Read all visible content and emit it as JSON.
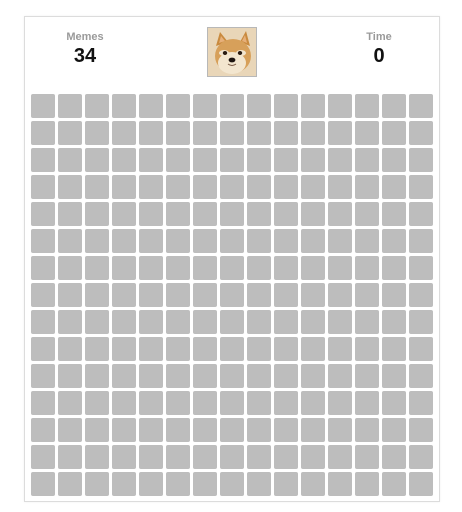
{
  "game": {
    "memes_label": "Memes",
    "memes_count": "34",
    "time_label": "Time",
    "time_value": "0",
    "face_icon": "doge-face-icon",
    "board": {
      "rows": 15,
      "cols": 15,
      "cell_state": "covered",
      "cell_color": "#bdbdbd"
    }
  }
}
